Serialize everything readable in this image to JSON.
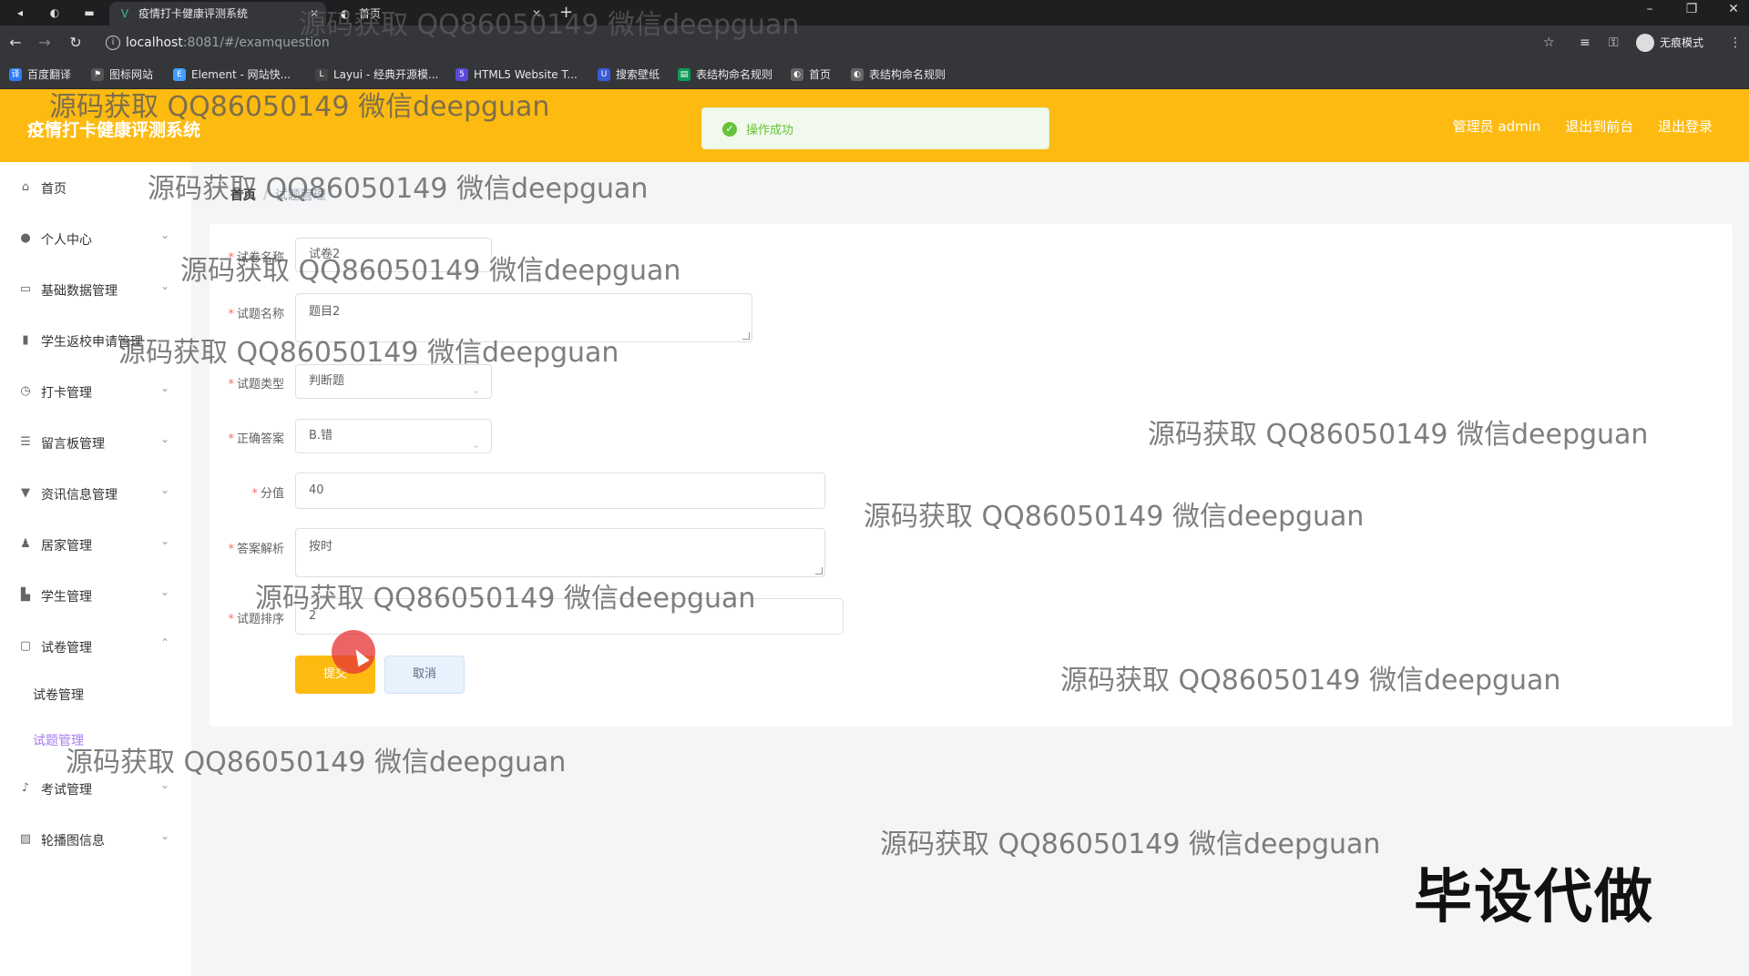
{
  "browser": {
    "tabs": [
      {
        "label": "疫情打卡健康评测系统",
        "active": true
      },
      {
        "label": "首页",
        "active": false
      }
    ],
    "url_host": "localhost",
    "url_rest": ":8081/#/examquestion",
    "incognito_label": "无痕模式",
    "bookmarks": [
      {
        "label": "百度翻译",
        "icon": "translate-icon",
        "color": "#2d7cf6"
      },
      {
        "label": "图标网站",
        "icon": "flag-icon",
        "color": "#555555"
      },
      {
        "label": "Element - 网站快...",
        "icon": "element-icon",
        "color": "#409eff"
      },
      {
        "label": "Layui - 经典开源模...",
        "icon": "layui-icon",
        "color": "#444444"
      },
      {
        "label": "HTML5 Website T...",
        "icon": "html5-icon",
        "color": "#5b4ad8"
      },
      {
        "label": "搜索壁纸",
        "icon": "wallpaper-icon",
        "color": "#3b5bd6"
      },
      {
        "label": "表结构命名规则",
        "icon": "doc-icon",
        "color": "#0f9d58"
      },
      {
        "label": "首页",
        "icon": "globe-icon",
        "color": "#666666"
      },
      {
        "label": "表结构命名规则",
        "icon": "globe-icon",
        "color": "#666666"
      }
    ]
  },
  "header": {
    "title": "疫情打卡健康评测系统",
    "user_label": "管理员 admin",
    "back_label": "退出到前台",
    "logout_label": "退出登录",
    "brand_color": "#fdbb12"
  },
  "toast": {
    "message": "操作成功"
  },
  "sidebar": {
    "items": [
      {
        "label": "首页",
        "icon": "home-icon",
        "arrow": false
      },
      {
        "label": "个人中心",
        "icon": "user-icon",
        "arrow": true
      },
      {
        "label": "基础数据管理",
        "icon": "data-icon",
        "arrow": true
      },
      {
        "label": "学生返校申请管理",
        "icon": "chart-icon",
        "arrow": false
      },
      {
        "label": "打卡管理",
        "icon": "clock-icon",
        "arrow": true
      },
      {
        "label": "留言板管理",
        "icon": "list-icon",
        "arrow": true
      },
      {
        "label": "资讯信息管理",
        "icon": "news-icon",
        "arrow": true
      },
      {
        "label": "居家管理",
        "icon": "person-icon",
        "arrow": true
      },
      {
        "label": "学生管理",
        "icon": "student-icon",
        "arrow": true
      },
      {
        "label": "试卷管理",
        "icon": "paper-icon",
        "arrow": true
      },
      {
        "label": "考试管理",
        "icon": "mic-icon",
        "arrow": true
      },
      {
        "label": "轮播图信息",
        "icon": "image-icon",
        "arrow": true
      }
    ],
    "subitems": [
      {
        "label": "试卷管理",
        "active": false
      },
      {
        "label": "试题管理",
        "active": true
      }
    ]
  },
  "breadcrumb": {
    "home": "首页",
    "current": "试题管理"
  },
  "form": {
    "paper": {
      "label": "试卷名称",
      "value": "试卷2"
    },
    "name": {
      "label": "试题名称",
      "value": "题目2"
    },
    "type": {
      "label": "试题类型",
      "value": "判断题"
    },
    "answer": {
      "label": "正确答案",
      "value": "B.错"
    },
    "score": {
      "label": "分值",
      "value": "40"
    },
    "analysis": {
      "label": "答案解析",
      "value": "按时"
    },
    "order": {
      "label": "试题排序",
      "value": "2"
    },
    "submit_label": "提交",
    "cancel_label": "取消"
  },
  "watermark": "源码获取 QQ86050149 微信deepguan",
  "corner_stamp": "毕设代做"
}
